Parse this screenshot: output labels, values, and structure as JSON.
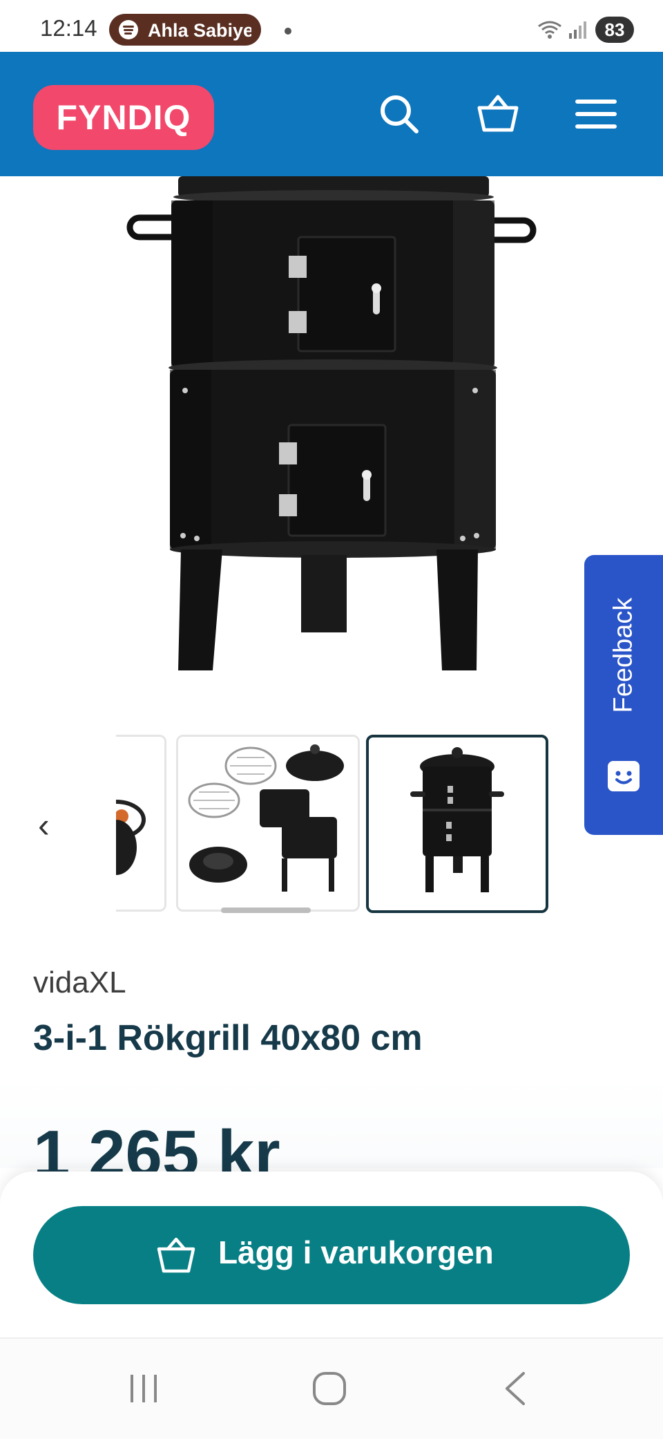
{
  "status_bar": {
    "time": "12:14",
    "now_playing": "Ahla Sabiye",
    "battery": "83"
  },
  "header": {
    "logo": "FYNDIQ",
    "brand_color": "#0d76bd",
    "logo_color": "#f2486b",
    "icons": [
      "search-icon",
      "cart-icon",
      "menu-icon"
    ]
  },
  "gallery": {
    "thumbnail_count": 3,
    "selected_index": 2
  },
  "feedback": {
    "label": "Feedback"
  },
  "product": {
    "brand": "vidaXL",
    "title": "3-i-1 Rökgrill 40x80 cm",
    "price": "1 265 kr"
  },
  "cart_button": {
    "label": "Lägg i varukorgen",
    "color": "#077f84"
  },
  "nav_bar": {
    "icons": [
      "recents-icon",
      "home-icon",
      "back-icon"
    ]
  }
}
